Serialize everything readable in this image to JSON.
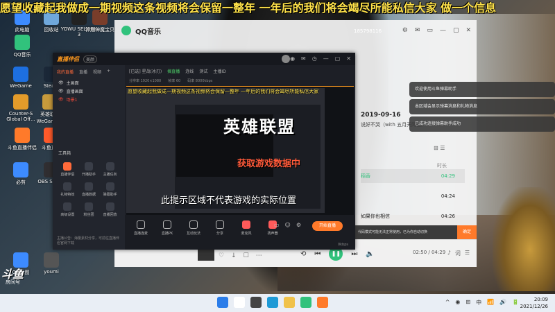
{
  "danmu_top": "愿望收藏起我做成一期视频这条视频将会保留一整年 一年后的我们将会竭尽所能私信大家 做一个信息",
  "desktop_icons": [
    {
      "label": "此电脑",
      "color": "#3d8bff"
    },
    {
      "label": "回收站",
      "color": "#6fa8dc"
    },
    {
      "label": "YOWU SELKIRK 3",
      "color": "#222222"
    },
    {
      "label": "钟馗神魔宝贝",
      "color": "#7a3d2a"
    },
    {
      "label": "QQ音乐",
      "color": "#31c27c"
    },
    {
      "label": "WeGame",
      "color": "#1d6fe0"
    },
    {
      "label": "Steam",
      "color": "#1b2838"
    },
    {
      "label": "Counter-S Global Off...",
      "color": "#e39b2a"
    },
    {
      "label": "英雄联盟 WeGame版",
      "color": "#c89b3c"
    },
    {
      "label": "斗鱼直播伴侣",
      "color": "#ff7a2a"
    },
    {
      "label": "斗鱼直播",
      "color": "#ff5a2a"
    },
    {
      "label": "必剪",
      "color": "#3d8bff"
    },
    {
      "label": "OBS Studio",
      "color": "#302e31"
    },
    {
      "label": "QQ截图",
      "color": "#3d8bff"
    },
    {
      "label": "youmi",
      "color": "#555555"
    }
  ],
  "qq_music": {
    "brand": "QQ音乐",
    "user_id": "185798116",
    "window_buttons": [
      "⚙",
      "✉",
      "▭",
      "—",
      "▢",
      "✕"
    ],
    "song_date": "2019-09-16",
    "song_subtitle": "说好不哭（with 五月天阿信）",
    "time_header": "时长",
    "tracks": [
      {
        "name": "稻香",
        "time": "04:29",
        "selected": true
      },
      {
        "name": "",
        "time": "04:24",
        "selected": false
      },
      {
        "name": "如果你也相信",
        "time": "04:26",
        "selected": false
      }
    ],
    "play_time": "02:50 / 04:29",
    "play_icon": "❚❚"
  },
  "streamer": {
    "brand": "直播伴侣",
    "version_badge": "美颜",
    "tool_icons": [
      "◉",
      "✉",
      "◷",
      "—",
      "▢",
      "✕"
    ],
    "side_tabs": [
      "我的直播",
      "直播",
      "视频",
      "+"
    ],
    "scenes": [
      {
        "label": "主画面",
        "active": false
      },
      {
        "label": "直播画面",
        "active": false
      },
      {
        "label": "场景1",
        "active": true
      }
    ],
    "tools_title": "工具箱",
    "tools": [
      {
        "label": "直播伴侣",
        "hot": true
      },
      {
        "label": "开播助手",
        "hot": false
      },
      {
        "label": "主播任务",
        "hot": false
      },
      {
        "label": "礼物特效",
        "hot": false
      },
      {
        "label": "直播数据",
        "hot": false
      },
      {
        "label": "弹幕助手",
        "hot": false
      },
      {
        "label": "高级设置",
        "hot": false
      },
      {
        "label": "粉丝团",
        "hot": false
      },
      {
        "label": "直播回放",
        "hot": false
      }
    ],
    "side_footer": "主播公告：海量素材分享，可前往直播伴侣官网下载",
    "main_top": [
      "[已选] 星战(冰刃)",
      "搞直播",
      "连线",
      "测试",
      "主播ID"
    ],
    "main_top2": [
      "分辨率 1920×1080",
      "帧率 60",
      "码率 8000kbps"
    ],
    "danmu_mid": "愿望收藏起我做成一期视频这条视频将会保留一整年 一年后的我们将会竭尽所能私信大家",
    "big_text": "英雄联盟",
    "loading_text": "获取游戏数据中",
    "hint_text": "此提示区域不代表游戏的实际位置",
    "bottom_buttons": [
      {
        "label": "直播连麦",
        "red": false
      },
      {
        "label": "直播PK",
        "red": false
      },
      {
        "label": "互动玩法",
        "red": false
      },
      {
        "label": "分享",
        "red": false
      },
      {
        "label": "麦克风",
        "red": true
      },
      {
        "label": "扬声器",
        "red": true
      }
    ],
    "go_live": "开始直播",
    "bitrate": "0kbps"
  },
  "notifications": [
    {
      "text": "欢迎使用斗鱼弹幕助手"
    },
    {
      "text": "本区域会显示弹幕消息和礼物消息"
    },
    {
      "text": "已成功连接弹幕助手成功"
    }
  ],
  "bar_notif": {
    "text": "代码模式可能无法正常使用，已为你自动切换",
    "confirm": "确定"
  },
  "douyu": {
    "brand": "斗鱼",
    "sub": "房间号"
  },
  "taskbar": {
    "apps": [
      {
        "name": "windows-start-icon",
        "color": "#2b7de9"
      },
      {
        "name": "search-icon",
        "color": "#ffffff"
      },
      {
        "name": "task-view-icon",
        "color": "#444444"
      },
      {
        "name": "edge-icon",
        "color": "#1e9ad6"
      },
      {
        "name": "file-explorer-icon",
        "color": "#f0c24a"
      },
      {
        "name": "qq-music-icon",
        "color": "#31c27c"
      },
      {
        "name": "douyu-icon",
        "color": "#ff7a2a"
      }
    ],
    "tray": [
      "^",
      "◉",
      "⊞",
      "中",
      "📶",
      "🔊",
      "🔋"
    ],
    "time": "20:09",
    "date": "2021/12/26"
  }
}
